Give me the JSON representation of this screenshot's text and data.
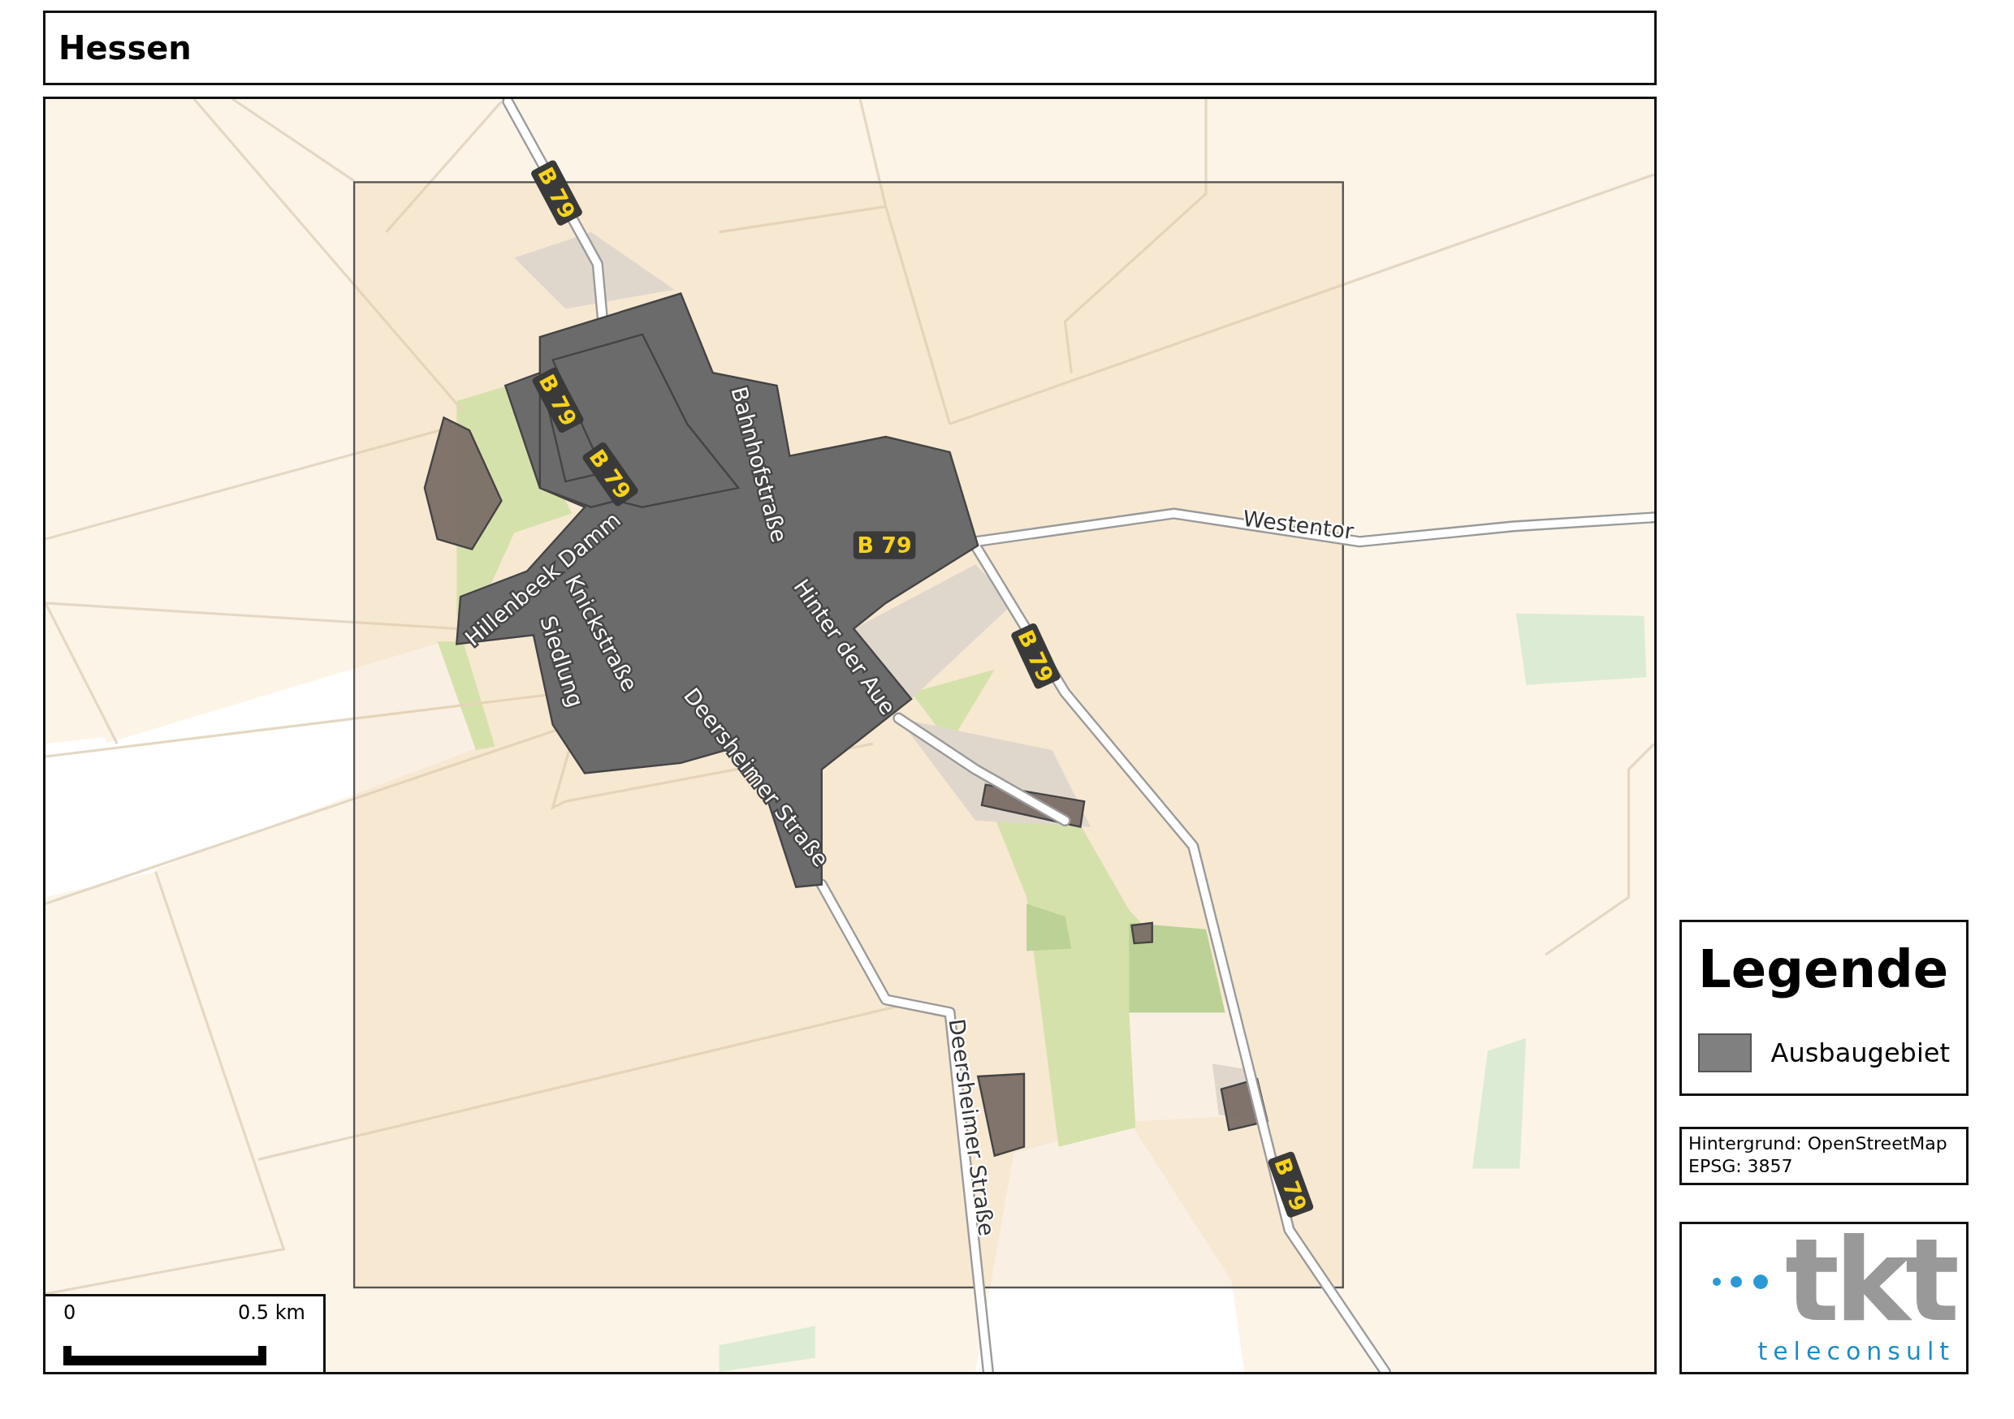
{
  "title": "Hessen",
  "map": {
    "labels": [
      {
        "text": "B 79",
        "kind": "route"
      },
      {
        "text": "B 79",
        "kind": "route"
      },
      {
        "text": "B 79",
        "kind": "route"
      },
      {
        "text": "Bahnhofstraße",
        "kind": "inner"
      },
      {
        "text": "B 79",
        "kind": "route"
      },
      {
        "text": "Westentor",
        "kind": "outer"
      },
      {
        "text": "Hillenbeek Damm",
        "kind": "inner"
      },
      {
        "text": "Knickstraße",
        "kind": "inner"
      },
      {
        "text": "Siedlung",
        "kind": "inner"
      },
      {
        "text": "Hinter der Aue",
        "kind": "inner"
      },
      {
        "text": "B 79",
        "kind": "route"
      },
      {
        "text": "Deersheimer Straße",
        "kind": "inner"
      },
      {
        "text": "Deersheimer Straße",
        "kind": "outer"
      },
      {
        "text": "B 79",
        "kind": "route"
      }
    ]
  },
  "scale_bar": {
    "start": "0",
    "end": "0.5 km"
  },
  "legend": {
    "title": "Legende",
    "items": [
      {
        "label": "Ausbaugebiet"
      }
    ]
  },
  "info": [
    "Hintergrund: OpenStreetMap",
    "EPSG: 3857"
  ],
  "logo": {
    "wordmark": "tkt",
    "tagline": "teleconsult"
  }
}
